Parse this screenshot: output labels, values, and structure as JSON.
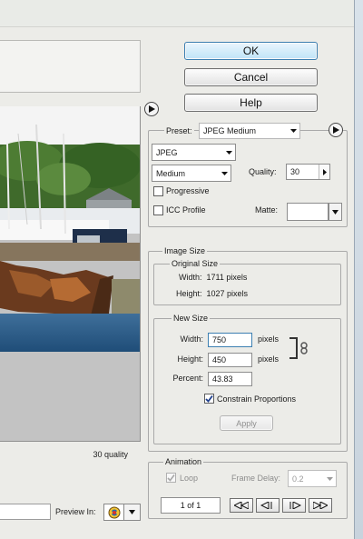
{
  "dialog": {
    "buttons": {
      "ok": "OK",
      "cancel": "Cancel",
      "help": "Help"
    }
  },
  "preview": {
    "quality_status": "30 quality",
    "preview_in_label": "Preview In:",
    "browser_icon": "browser-globe-icon"
  },
  "settings": {
    "preset_label": "Preset:",
    "preset_value": "JPEG Medium",
    "format_value": "JPEG",
    "compression_value": "Medium",
    "quality_label": "Quality:",
    "quality_value": "30",
    "progressive_label": "Progressive",
    "progressive_checked": false,
    "icc_label": "ICC Profile",
    "icc_checked": false,
    "matte_label": "Matte:",
    "matte_color": "#ffffff"
  },
  "image_size": {
    "group_label": "Image Size",
    "original": {
      "label": "Original Size",
      "width_text": "Width:  1711 pixels",
      "height_text": "Height:  1027 pixels"
    },
    "new_size": {
      "label": "New Size",
      "width_label": "Width:",
      "width_value": "750",
      "width_unit": "pixels",
      "height_label": "Height:",
      "height_value": "450",
      "height_unit": "pixels",
      "percent_label": "Percent:",
      "percent_value": "43.83",
      "constrain_label": "Constrain Proportions",
      "constrain_checked": true,
      "apply_label": "Apply"
    }
  },
  "animation": {
    "group_label": "Animation",
    "loop_label": "Loop",
    "loop_checked": true,
    "frame_delay_label": "Frame Delay:",
    "frame_delay_value": "0.2",
    "frame_counter": "1 of 1"
  },
  "colors": {
    "accent_border": "#3c7fb1",
    "dialog_bg": "#ecece8",
    "preview_bg": "#c3c3c3"
  }
}
